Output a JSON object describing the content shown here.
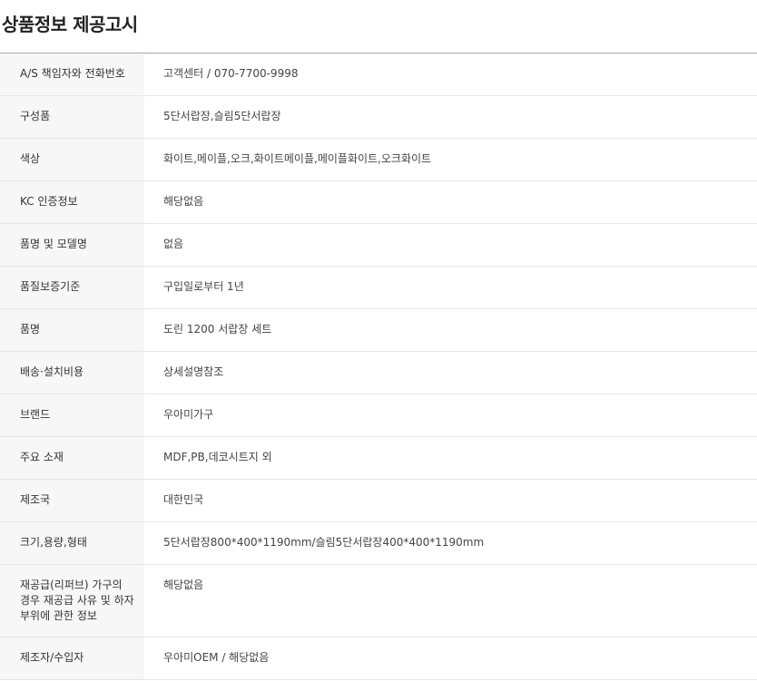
{
  "title": "상품정보 제공고시",
  "rows": [
    {
      "label": "A/S 책임자와 전화번호",
      "value": "고객센터 / 070-7700-9998"
    },
    {
      "label": "구성품",
      "value": "5단서랍장,슬림5단서랍장"
    },
    {
      "label": "색상",
      "value": "화이트,메이플,오크,화이트메이플,메이플화이트,오크화이트"
    },
    {
      "label": "KC 인증정보",
      "value": "해당없음"
    },
    {
      "label": "품명 및 모델명",
      "value": "없음"
    },
    {
      "label": "품질보증기준",
      "value": "구입일로부터 1년"
    },
    {
      "label": "품명",
      "value": "도린 1200 서랍장 세트"
    },
    {
      "label": "배송·설치비용",
      "value": "상세설명참조"
    },
    {
      "label": "브랜드",
      "value": "우아미가구"
    },
    {
      "label": "주요 소재",
      "value": "MDF,PB,데코시트지 외"
    },
    {
      "label": "제조국",
      "value": "대한민국"
    },
    {
      "label": "크기,용량,형태",
      "value": "5단서랍장800*400*1190mm/슬림5단서랍장400*400*1190mm"
    },
    {
      "label": "재공급(리퍼브) 가구의 경우 재공급 사유 및 하자 부위에 관한 정보",
      "value": "해당없음"
    },
    {
      "label": "제조자/수입자",
      "value": "우아미OEM / 해당없음"
    }
  ]
}
